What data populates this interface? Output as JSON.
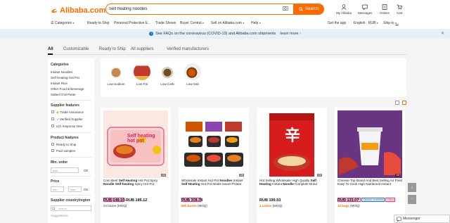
{
  "header": {
    "logo_text": "Alibaba.com",
    "search_value": "Self heating noodles",
    "search_button": "Search",
    "icons": [
      {
        "label": "My Alibaba",
        "icon": "user-icon"
      },
      {
        "label": "Messages",
        "icon": "message-icon"
      },
      {
        "label": "Orders",
        "icon": "orders-icon"
      },
      {
        "label": "Cart",
        "icon": "cart-icon"
      }
    ],
    "subnav": {
      "categories": "Categories",
      "ready_to_ship": "Ready to Ship",
      "ppe": "Personal Protective E...",
      "trade_shows": "Trade Shows",
      "buyer_central": "Buyer Central",
      "sell": "Sell on Alibaba.com",
      "help": "Help",
      "get_app": "Get the app",
      "language": "English · RUB",
      "ship_to": "Ship to"
    }
  },
  "banner": {
    "text": "See FAQs on the coronavirus (COVID-19) and Alibaba.com shipments",
    "link": "learn more"
  },
  "tabs": [
    "All",
    "Customizable",
    "Ready to Ship",
    "All suppliers",
    "Verified manufacturers"
  ],
  "sidebar": {
    "categories_heading": "Categories",
    "categories": [
      "Instant Noodles",
      "Self Heating Hot Pot",
      "Instant Rice",
      "Other Food & Beverage",
      "Salted Chili Paste"
    ],
    "supplier_heading": "Supplier features",
    "supplier_features": [
      "Trade Assurance",
      "Verified Supplier",
      "≤1h response time"
    ],
    "product_heading": "Product features",
    "product_features": [
      "Ready to Ship",
      "Paid samples"
    ],
    "min_order_heading": "Min. order",
    "min_order_placeholder": "less",
    "ok": "OK",
    "price_heading": "Price",
    "price_min": "min",
    "price_max": "max",
    "region_heading": "Supplier country/region",
    "region_search": "search",
    "suggestions": "Suggestions"
  },
  "category_strip": [
    "Low-Sodium",
    "Low-Fat",
    "Low-Carb",
    "Low-Salt"
  ],
  "products": [
    {
      "title_pre": "Com Beef ",
      "title_bold1": "Self Heating",
      "title_mid": " Hot Pot Spicy ",
      "title_bold2": "Noodle Self-heating",
      "title_post": " Spicy Hot Pot",
      "tags": [
        "Spicy",
        "Instant"
      ],
      "price": "RUB 148.10-RUB 185.12",
      "moq": "24 boxes",
      "moq_suffix": "(MOQ)",
      "img_badge": "1/6",
      "img_text": "Self heating hot pot"
    },
    {
      "title_pre": "Wholesale Instant Hot Pot ",
      "title_bold1": "Noodles",
      "title_mid": " Instant ",
      "title_bold2": "Self Heating",
      "title_post": " Hot Pot Meals Sweet Potato",
      "tags": [
        "Ready to Ship"
      ],
      "price": "RUB 308.78",
      "moq": "800 boxes",
      "moq_suffix": "(MOQ)",
      "img_badge": "1/6",
      "img_text": ""
    },
    {
      "title_pre": "Hot Selling Wholesale High Quality ",
      "title_bold1": "Self Heating",
      "title_mid": " Instant ",
      "title_bold2": "Noodle",
      "title_post": " Complete Dried",
      "tags": [],
      "price": "RUB 199.93",
      "moq": "1 carton",
      "moq_suffix": "(MOQ)",
      "img_badge": "1/6",
      "img_text": "辛"
    },
    {
      "title_pre": "Chinese Top Brand And Best Selling Air Fried Easy To Cook High Nutritional Instant",
      "title_bold1": "",
      "title_mid": "",
      "title_bold2": "",
      "title_post": "",
      "tags": [
        "One-stop Service",
        "Sample available",
        "Video"
      ],
      "price": "RUB 131.07",
      "moq": "12 bags",
      "moq_suffix": "(MOQ)",
      "img_badge": "1/6",
      "img_text": ""
    }
  ],
  "messenger": "Messenger",
  "colors": {
    "accent": "#ff6a00",
    "banner": "#e6f0fb",
    "link": "#1e6fd9"
  }
}
